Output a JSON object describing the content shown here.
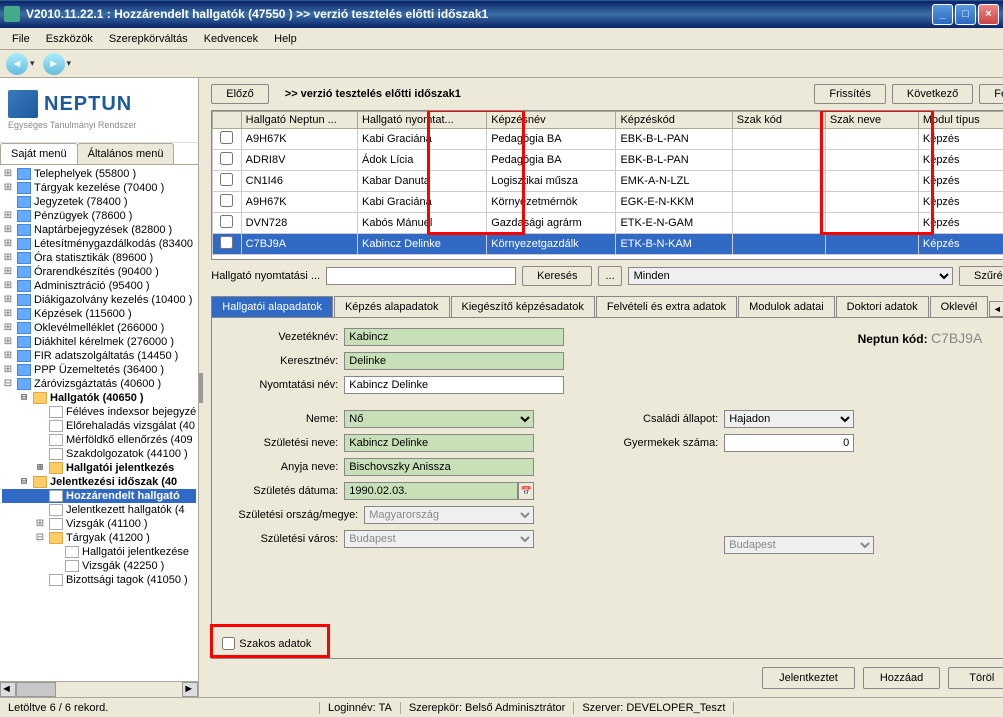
{
  "title": "V2010.11.22.1 : Hozzárendelt hallgatók (47550  )   >> verzió tesztelés előtti időszak1",
  "menu": [
    "File",
    "Eszközök",
    "Szerepkörváltás",
    "Kedvencek",
    "Help"
  ],
  "logo": {
    "main": "NEPTUN",
    "sub": "Egységes Tanulmányi Rendszer"
  },
  "side_tabs": {
    "own": "Saját menü",
    "general": "Általános menü"
  },
  "tree": [
    {
      "label": "Telephelyek (55800  )",
      "lvl": 0,
      "exp": "+",
      "icon": "blue"
    },
    {
      "label": "Tárgyak kezelése (70400  )",
      "lvl": 0,
      "exp": "+",
      "icon": "blue"
    },
    {
      "label": "Jegyzetek (78400  )",
      "lvl": 0,
      "exp": "",
      "icon": "blue"
    },
    {
      "label": "Pénzügyek (78600  )",
      "lvl": 0,
      "exp": "+",
      "icon": "blue"
    },
    {
      "label": "Naptárbejegyzések (82800  )",
      "lvl": 0,
      "exp": "+",
      "icon": "blue"
    },
    {
      "label": "Létesítménygazdálkodás (83400",
      "lvl": 0,
      "exp": "+",
      "icon": "blue"
    },
    {
      "label": "Óra statisztikák (89600  )",
      "lvl": 0,
      "exp": "+",
      "icon": "blue"
    },
    {
      "label": "Órarendkészítés (90400  )",
      "lvl": 0,
      "exp": "+",
      "icon": "blue"
    },
    {
      "label": "Adminisztráció (95400  )",
      "lvl": 0,
      "exp": "+",
      "icon": "blue"
    },
    {
      "label": "Diákigazolvány kezelés (10400  )",
      "lvl": 0,
      "exp": "+",
      "icon": "blue"
    },
    {
      "label": "Képzések (115600  )",
      "lvl": 0,
      "exp": "+",
      "icon": "blue"
    },
    {
      "label": "Oklevélmelléklet (266000  )",
      "lvl": 0,
      "exp": "+",
      "icon": "blue"
    },
    {
      "label": "Diákhitel kérelmek (276000  )",
      "lvl": 0,
      "exp": "+",
      "icon": "blue"
    },
    {
      "label": "FIR adatszolgáltatás (14450  )",
      "lvl": 0,
      "exp": "+",
      "icon": "blue"
    },
    {
      "label": "PPP Üzemeltetés (36400  )",
      "lvl": 0,
      "exp": "+",
      "icon": "blue"
    },
    {
      "label": "Záróvizsgáztatás (40600  )",
      "lvl": 0,
      "exp": "-",
      "icon": "blue"
    },
    {
      "label": "Hallgatók (40650  )",
      "lvl": 1,
      "exp": "-",
      "icon": "folder",
      "bold": true
    },
    {
      "label": "Féléves indexsor bejegyzé",
      "lvl": 2,
      "exp": "",
      "icon": "page"
    },
    {
      "label": "Előrehaladás vizsgálat (40",
      "lvl": 2,
      "exp": "",
      "icon": "page"
    },
    {
      "label": "Mérföldkő ellenőrzés (409",
      "lvl": 2,
      "exp": "",
      "icon": "page"
    },
    {
      "label": "Szakdolgozatok (44100  )",
      "lvl": 2,
      "exp": "",
      "icon": "page"
    },
    {
      "label": "Hallgatói jelentkezés",
      "lvl": 2,
      "exp": "+",
      "icon": "folder",
      "bold": true
    },
    {
      "label": "Jelentkezési időszak (40",
      "lvl": 1,
      "exp": "-",
      "icon": "folder",
      "bold": true
    },
    {
      "label": "Hozzárendelt hallgató",
      "lvl": 2,
      "exp": "",
      "icon": "page",
      "sel": true,
      "bold": true
    },
    {
      "label": "Jelentkezett hallgatók (4",
      "lvl": 2,
      "exp": "",
      "icon": "page"
    },
    {
      "label": "Vizsgák (41100  )",
      "lvl": 2,
      "exp": "+",
      "icon": "page"
    },
    {
      "label": "Tárgyak (41200  )",
      "lvl": 2,
      "exp": "-",
      "icon": "folder"
    },
    {
      "label": "Hallgatói jelentkezése",
      "lvl": 3,
      "exp": "",
      "icon": "page"
    },
    {
      "label": "Vizsgák (42250  )",
      "lvl": 3,
      "exp": "",
      "icon": "page"
    },
    {
      "label": "Bizottsági tagok (41050  )",
      "lvl": 2,
      "exp": "",
      "icon": "page"
    }
  ],
  "top": {
    "prev": "Előző",
    "label": ">> verzió tesztelés előtti időszak1",
    "refresh": "Frissítés",
    "next": "Következő",
    "up": "Fel"
  },
  "grid": {
    "headers": [
      "Hallgató Neptun ...",
      "Hallgató nyomtat...",
      "Képzésnév",
      "Képzéskód",
      "Szak kód",
      "Szak neve",
      "Modul típus"
    ],
    "rows": [
      [
        "A9H67K",
        "Kabi Graciána",
        "Pedagógia BA",
        "EBK-B-L-PAN",
        "",
        "",
        "Képzés"
      ],
      [
        "ADRI8V",
        "Ádok Lícia",
        "Pedagógia BA",
        "EBK-B-L-PAN",
        "",
        "",
        "Képzés"
      ],
      [
        "CN1I46",
        "Kabar Danuta",
        "Logisztikai műsza",
        "EMK-A-N-LZL",
        "",
        "",
        "Képzés"
      ],
      [
        "A9H67K",
        "Kabi Graciána",
        "Környezetmérnök",
        "EGK-E-N-KKM",
        "",
        "",
        "Képzés"
      ],
      [
        "DVN728",
        "Kabós Mánuel",
        "Gazdasági agrárm",
        "ETK-E-N-GAM",
        "",
        "",
        "Képzés"
      ],
      [
        "C7BJ9A",
        "Kabincz Delinke",
        "Környezetgazdálk",
        "ETK-B-N-KAM",
        "",
        "",
        "Képzés"
      ]
    ]
  },
  "search": {
    "label": "Hallgató nyomtatási ...",
    "btn": "Keresés",
    "all": "Minden",
    "filter": "Szűrés"
  },
  "tabs": [
    "Hallgatói alapadatok",
    "Képzés alapadatok",
    "Kiegészítő képzésadatok",
    "Felvételi és extra adatok",
    "Modulok adatai",
    "Doktori adatok",
    "Oklevél"
  ],
  "form": {
    "vezeteknev_l": "Vezetéknév:",
    "vezeteknev": "Kabincz",
    "keresztnev_l": "Keresztnév:",
    "keresztnev": "Delinke",
    "nyomtatasi_l": "Nyomtatási név:",
    "nyomtatasi": "Kabincz Delinke",
    "neme_l": "Neme:",
    "neme": "Nő",
    "szulnev_l": "Születési neve:",
    "szulnev": "Kabincz Delinke",
    "anyja_l": "Anyja neve:",
    "anyja": "Bischovszky Anissza",
    "szuldat_l": "Születés dátuma:",
    "szuldat": "1990.02.03.",
    "szulorszag_l": "Születési ország/megye:",
    "szulorszag": "Magyarország",
    "szulmegye": "Budapest",
    "szulvaros_l": "Születési város:",
    "szulvaros": "Budapest",
    "csalad_l": "Családi állapot:",
    "csalad": "Hajadon",
    "gyermek_l": "Gyermekek száma:",
    "gyermek": "0",
    "neptun_l": "Neptun kód:",
    "neptun": "C7BJ9A",
    "szakos": "Szakos adatok"
  },
  "bottom": {
    "jel": "Jelentkeztet",
    "add": "Hozzáad",
    "del": "Töröl"
  },
  "status": {
    "rec": "Letöltve 6 / 6 rekord.",
    "login": "Loginnév: TA",
    "role": "Szerepkör: Belső Adminisztrátor",
    "server": "Szerver: DEVELOPER_Teszt"
  }
}
